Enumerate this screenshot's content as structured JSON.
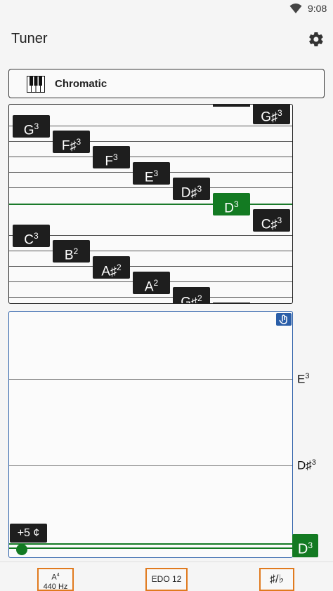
{
  "status_bar": {
    "time": "9:08",
    "wifi_icon": "wifi-icon"
  },
  "app_bar": {
    "title": "Tuner",
    "settings_icon": "gear-icon"
  },
  "instrument": {
    "label": "Chromatic",
    "icon": "piano-icon"
  },
  "staff_notes": [
    {
      "name": "G",
      "octave": "3",
      "accidental": "",
      "active": false
    },
    {
      "name": "F",
      "octave": "3",
      "accidental": "♯",
      "active": false
    },
    {
      "name": "F",
      "octave": "3",
      "accidental": "",
      "active": false
    },
    {
      "name": "E",
      "octave": "3",
      "accidental": "",
      "active": false
    },
    {
      "name": "D",
      "octave": "3",
      "accidental": "♯",
      "active": false
    },
    {
      "name": "D",
      "octave": "3",
      "accidental": "",
      "active": true
    },
    {
      "name": "C",
      "octave": "3",
      "accidental": "♯",
      "active": false
    },
    {
      "name": "C",
      "octave": "3",
      "accidental": "",
      "active": false
    },
    {
      "name": "B",
      "octave": "2",
      "accidental": "",
      "active": false
    },
    {
      "name": "A",
      "octave": "2",
      "accidental": "♯",
      "active": false
    },
    {
      "name": "A",
      "octave": "2",
      "accidental": "",
      "active": false
    },
    {
      "name": "G",
      "octave": "2",
      "accidental": "♯",
      "active": false
    },
    {
      "name": "G",
      "octave": "3",
      "accidental": "♯",
      "active": false
    }
  ],
  "graph": {
    "cents_deviation": "+5 ¢",
    "labels": [
      {
        "name": "E",
        "octave": "3",
        "accidental": ""
      },
      {
        "name": "D",
        "octave": "3",
        "accidental": "♯"
      },
      {
        "name": "D",
        "octave": "3",
        "accidental": ""
      }
    ],
    "touch_icon": "hand-pointer-icon"
  },
  "bottom_bar": {
    "reference_note": "A",
    "reference_octave": "4",
    "reference_freq": "440 Hz",
    "temperament": "EDO 12",
    "accidental_toggle": "♯/♭"
  },
  "colors": {
    "accent": "#137a22",
    "graph_border": "#2a5ea8",
    "button_border": "#e07a1e"
  }
}
